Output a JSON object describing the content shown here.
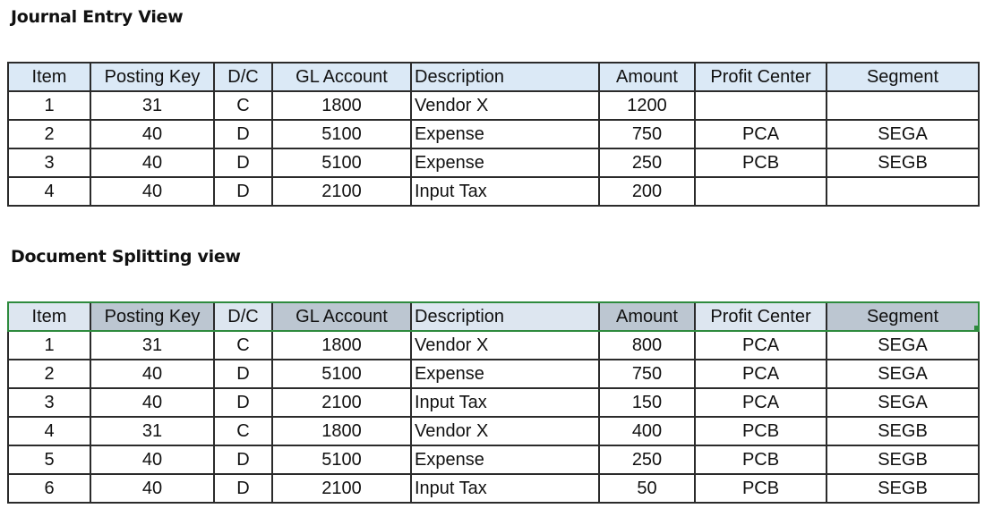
{
  "journal": {
    "title": "Journal Entry View",
    "columns": [
      "Item",
      "Posting Key",
      "D/C",
      "GL Account",
      "Description",
      "Amount",
      "Profit Center",
      "Segment"
    ],
    "rows": [
      [
        "1",
        "31",
        "C",
        "1800",
        "Vendor X",
        "1200",
        "",
        ""
      ],
      [
        "2",
        "40",
        "D",
        "5100",
        "Expense",
        "750",
        "PCA",
        "SEGA"
      ],
      [
        "3",
        "40",
        "D",
        "5100",
        "Expense",
        "250",
        "PCB",
        "SEGB"
      ],
      [
        "4",
        "40",
        "D",
        "2100",
        "Input Tax",
        "200",
        "",
        ""
      ]
    ]
  },
  "splitting": {
    "title": "Document Splitting view",
    "columns": [
      "Item",
      "Posting Key",
      "D/C",
      "GL Account",
      "Description",
      "Amount",
      "Profit Center",
      "Segment"
    ],
    "rows": [
      [
        "1",
        "31",
        "C",
        "1800",
        "Vendor X",
        "800",
        "PCA",
        "SEGA"
      ],
      [
        "2",
        "40",
        "D",
        "5100",
        "Expense",
        "750",
        "PCA",
        "SEGA"
      ],
      [
        "3",
        "40",
        "D",
        "2100",
        "Input Tax",
        "150",
        "PCA",
        "SEGA"
      ],
      [
        "4",
        "31",
        "C",
        "1800",
        "Vendor X",
        "400",
        "PCB",
        "SEGB"
      ],
      [
        "5",
        "40",
        "D",
        "5100",
        "Expense",
        "250",
        "PCB",
        "SEGB"
      ],
      [
        "6",
        "40",
        "D",
        "2100",
        "Input Tax",
        "50",
        "PCB",
        "SEGB"
      ]
    ]
  },
  "colors": {
    "journal_header_bg": "#dbe9f6",
    "split_header_bg": "#bcc6d1",
    "selection_border": "#2e8b3e"
  }
}
